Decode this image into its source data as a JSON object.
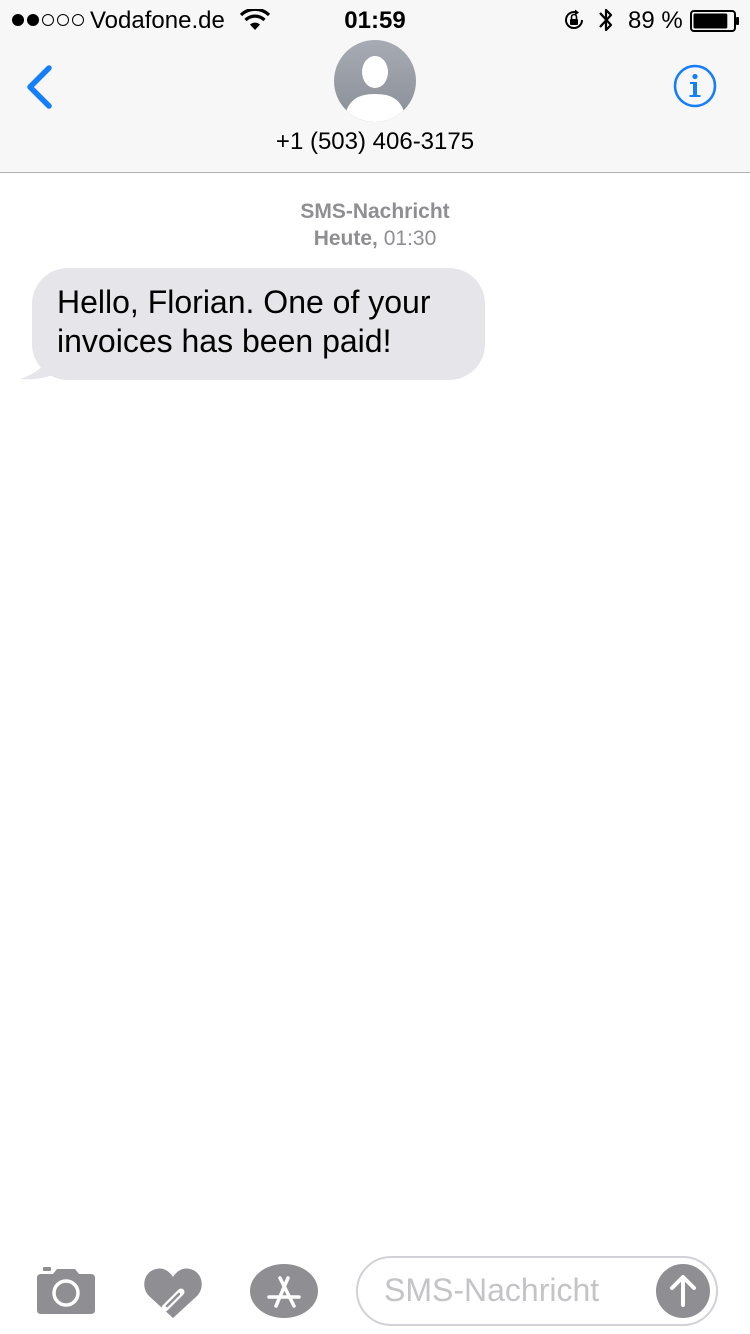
{
  "status_bar": {
    "carrier": "Vodafone.de",
    "time": "01:59",
    "battery_percent": "89 %",
    "signal_bars_filled": 2,
    "signal_bars_total": 5,
    "battery_level": 0.89,
    "icons": [
      "wifi-icon",
      "rotation-lock-icon",
      "bluetooth-icon",
      "battery-icon"
    ]
  },
  "nav": {
    "back_icon": "chevron-left-icon",
    "contact": "+1 (503) 406-3175",
    "info_icon": "info-icon",
    "accent_color": "#157efb"
  },
  "conversation": {
    "service": "SMS-Nachricht",
    "day": "Heute,",
    "time": "01:30",
    "messages": [
      {
        "direction": "incoming",
        "text": "Hello, Florian. One of your invoices has been paid!"
      }
    ],
    "bubble_color": "#e5e5ea"
  },
  "input_bar": {
    "placeholder": "SMS-Nachricht",
    "icons": [
      "camera-icon",
      "digital-touch-icon",
      "appstore-icon",
      "send-arrow-icon"
    ]
  }
}
